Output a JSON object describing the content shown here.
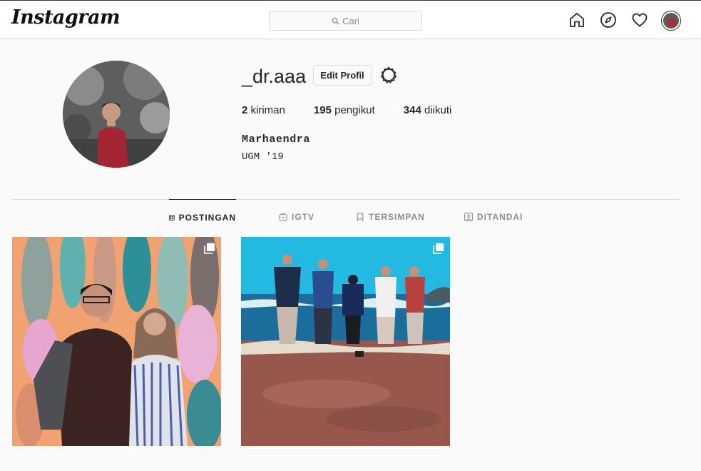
{
  "header": {
    "logo_text": "Instagram",
    "search_placeholder": "Cari",
    "icons": [
      "home-icon",
      "explore-icon",
      "heart-icon",
      "avatar"
    ]
  },
  "profile": {
    "username": "_dr.aaa",
    "edit_label": "Edit Profil",
    "stats": {
      "posts_count": "2",
      "posts_label": "kiriman",
      "followers_count": "195",
      "followers_label": "pengikut",
      "following_count": "344",
      "following_label": "diikuti"
    },
    "full_name": "Marhaendra",
    "bio": "UGM '19"
  },
  "tabs": [
    {
      "label": "POSTINGAN",
      "icon": "grid-icon",
      "active": true
    },
    {
      "label": "IGTV",
      "icon": "igtv-icon",
      "active": false
    },
    {
      "label": "TERSIMPAN",
      "icon": "bookmark-icon",
      "active": false
    },
    {
      "label": "DITANDAI",
      "icon": "tagged-icon",
      "active": false
    }
  ],
  "colors": {
    "background": "#fafafa",
    "border": "#dbdbdb",
    "text": "#262626",
    "muted": "#8e8e8e"
  }
}
